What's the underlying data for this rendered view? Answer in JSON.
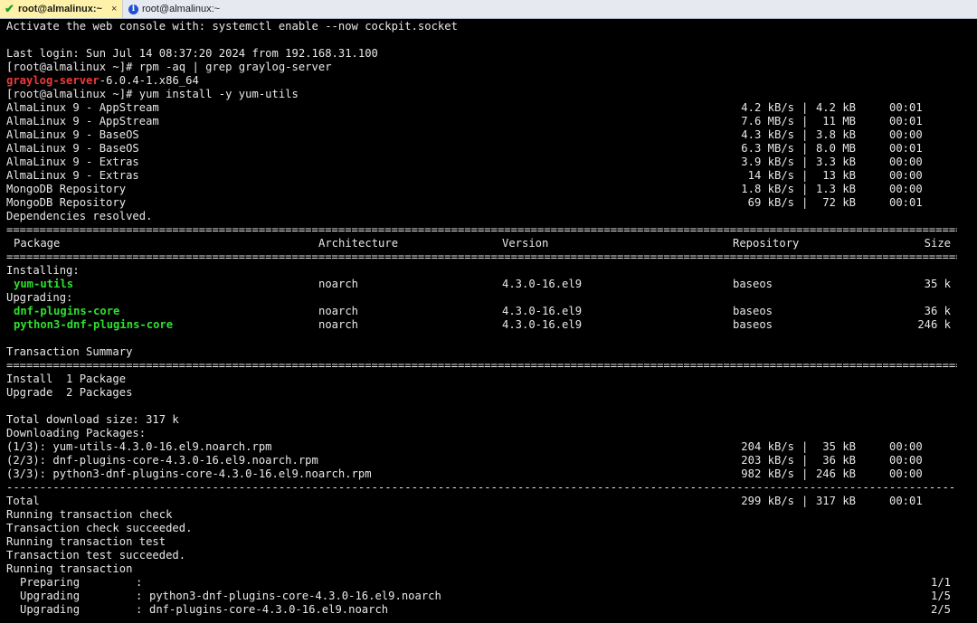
{
  "tabs": [
    {
      "label": "root@almalinux:~",
      "active": true,
      "status_icon": "check-icon",
      "close": "×"
    },
    {
      "label": "root@almalinux:~",
      "active": false,
      "status_icon": "info-icon"
    }
  ],
  "colors": {
    "background": "#000000",
    "text": "#e8e8e8",
    "highlight_green": "#2ee02e",
    "highlight_red": "#f03a3a",
    "active_tab": "#fff2a8"
  },
  "terminal": {
    "intro": [
      "Activate the web console with: systemctl enable --now cockpit.socket",
      "",
      "Last login: Sun Jul 14 08:37:20 2024 from 192.168.31.100",
      "[root@almalinux ~]# rpm -aq | grep graylog-server"
    ],
    "graylog_pkg": {
      "highlight": "graylog-server",
      "rest": "-6.0.4-1.x86_64"
    },
    "yum_command": "[root@almalinux ~]# yum install -y yum-utils",
    "repos": [
      {
        "name": "AlmaLinux 9 - AppStream",
        "speed": "4.2 kB/s",
        "size": "4.2 kB",
        "time": "00:01"
      },
      {
        "name": "AlmaLinux 9 - AppStream",
        "speed": "7.6 MB/s",
        "size": " 11 MB",
        "time": "00:01"
      },
      {
        "name": "AlmaLinux 9 - BaseOS",
        "speed": "4.3 kB/s",
        "size": "3.8 kB",
        "time": "00:00"
      },
      {
        "name": "AlmaLinux 9 - BaseOS",
        "speed": "6.3 MB/s",
        "size": "8.0 MB",
        "time": "00:01"
      },
      {
        "name": "AlmaLinux 9 - Extras",
        "speed": "3.9 kB/s",
        "size": "3.3 kB",
        "time": "00:00"
      },
      {
        "name": "AlmaLinux 9 - Extras",
        "speed": " 14 kB/s",
        "size": " 13 kB",
        "time": "00:00"
      },
      {
        "name": "MongoDB Repository",
        "speed": "1.8 kB/s",
        "size": "1.3 kB",
        "time": "00:00"
      },
      {
        "name": "MongoDB Repository",
        "speed": " 69 kB/s",
        "size": " 72 kB",
        "time": "00:01"
      }
    ],
    "deps_resolved": "Dependencies resolved.",
    "table_headers": {
      "package": "Package",
      "arch": "Architecture",
      "version": "Version",
      "repo": "Repository",
      "size": "Size"
    },
    "installing_label": "Installing:",
    "upgrading_label": "Upgrading:",
    "packages": [
      {
        "name": "yum-utils",
        "arch": "noarch",
        "version": "4.3.0-16.el9",
        "repo": "baseos",
        "size": "35 k"
      },
      {
        "name": "dnf-plugins-core",
        "arch": "noarch",
        "version": "4.3.0-16.el9",
        "repo": "baseos",
        "size": "36 k"
      },
      {
        "name": "python3-dnf-plugins-core",
        "arch": "noarch",
        "version": "4.3.0-16.el9",
        "repo": "baseos",
        "size": "246 k"
      }
    ],
    "transaction_summary": "Transaction Summary",
    "install_count": "Install  1 Package",
    "upgrade_count": "Upgrade  2 Packages",
    "total_download": "Total download size: 317 k",
    "downloading": "Downloading Packages:",
    "downloads": [
      {
        "name": "(1/3): yum-utils-4.3.0-16.el9.noarch.rpm",
        "speed": "204 kB/s",
        "size": " 35 kB",
        "time": "00:00"
      },
      {
        "name": "(2/3): dnf-plugins-core-4.3.0-16.el9.noarch.rpm",
        "speed": "203 kB/s",
        "size": " 36 kB",
        "time": "00:00"
      },
      {
        "name": "(3/3): python3-dnf-plugins-core-4.3.0-16.el9.noarch.rpm",
        "speed": "982 kB/s",
        "size": "246 kB",
        "time": "00:00"
      }
    ],
    "total": {
      "label": "Total",
      "speed": "299 kB/s",
      "size": "317 kB",
      "time": "00:01"
    },
    "progress_lines": [
      "Running transaction check",
      "Transaction check succeeded.",
      "Running transaction test",
      "Transaction test succeeded.",
      "Running transaction"
    ],
    "steps": [
      {
        "action": "Preparing",
        "target": "",
        "count": "1/1"
      },
      {
        "action": "Upgrading",
        "target": "python3-dnf-plugins-core-4.3.0-16.el9.noarch",
        "count": "1/5"
      },
      {
        "action": "Upgrading",
        "target": "dnf-plugins-core-4.3.0-16.el9.noarch",
        "count": "2/5"
      }
    ]
  }
}
